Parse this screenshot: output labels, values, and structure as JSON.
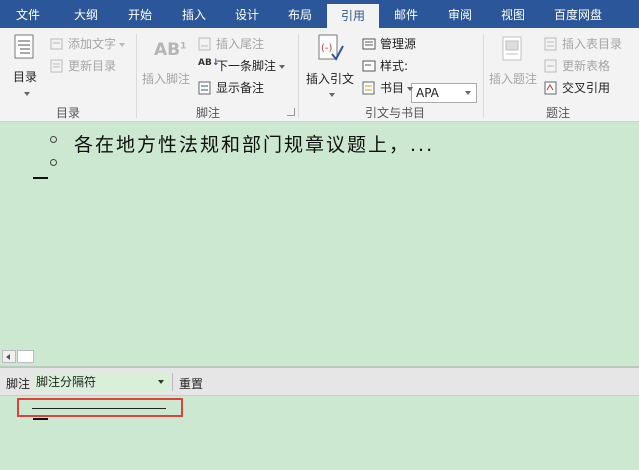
{
  "tabs": [
    "文件",
    "大纲",
    "开始",
    "插入",
    "设计",
    "布局",
    "引用",
    "邮件",
    "审阅",
    "视图",
    "百度网盘"
  ],
  "active_tab": "引用",
  "ribbon": {
    "toc": {
      "big_label": "目录",
      "add_text": "添加文字",
      "update_toc": "更新目录",
      "group_label": "目录"
    },
    "footnotes": {
      "insert_footnote": "插入脚注",
      "insert_endnote": "插入尾注",
      "next_footnote": "下一条脚注",
      "show_notes": "显示备注",
      "group_label": "脚注"
    },
    "citations": {
      "insert_citation": "插入引文",
      "manage_sources": "管理源",
      "style_label": "样式:",
      "style_value": "APA",
      "bibliography": "书目",
      "group_label": "引文与书目"
    },
    "captions": {
      "insert_caption": "插入题注",
      "insert_table_of_figures": "插入表目录",
      "update_table": "更新表格",
      "cross_reference": "交叉引用",
      "group_label": "题注"
    }
  },
  "document": {
    "line1": "各在地方性法规和部门规章议题上，..."
  },
  "footnote_pane": {
    "label": "脚注",
    "selected": "脚注分隔符",
    "reset": "重置"
  },
  "colors": {
    "tab_bar": "#2b579a",
    "document_bg": "#cde8d0",
    "highlight": "#e0413a"
  }
}
